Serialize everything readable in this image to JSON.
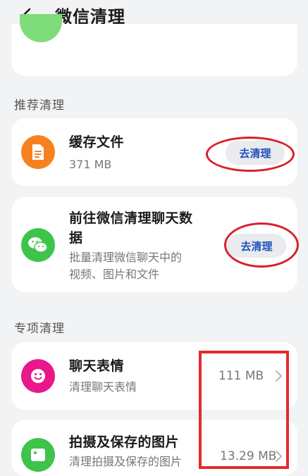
{
  "header": {
    "title": "微信清理",
    "back_icon": "arrow-left-icon"
  },
  "sections": {
    "recommended": "推荐清理",
    "special": "专项清理"
  },
  "recommended": {
    "cache": {
      "title": "缓存文件",
      "size": "371 MB",
      "button": "去清理",
      "icon": "document-icon",
      "color": "#f6821f"
    },
    "chat": {
      "title_line1": "前往微信清理聊天数",
      "title_line2": "据",
      "desc_line1": "批量清理微信聊天中的",
      "desc_line2": "视频、图片和文件",
      "button": "去清理",
      "icon": "wechat-icon",
      "color": "#3ec44a"
    }
  },
  "special": {
    "stickers": {
      "title": "聊天表情",
      "desc": "清理聊天表情",
      "size": "111 MB",
      "icon": "smiley-icon",
      "color": "#e8188a"
    },
    "photos": {
      "title": "拍摄及保存的图片",
      "desc": "清理拍摄及保存的图片",
      "size": "13.29 MB",
      "icon": "image-icon",
      "color": "#3ec44a"
    }
  },
  "colors": {
    "accent": "#1f4fb8",
    "annotation": "#d9202a"
  }
}
